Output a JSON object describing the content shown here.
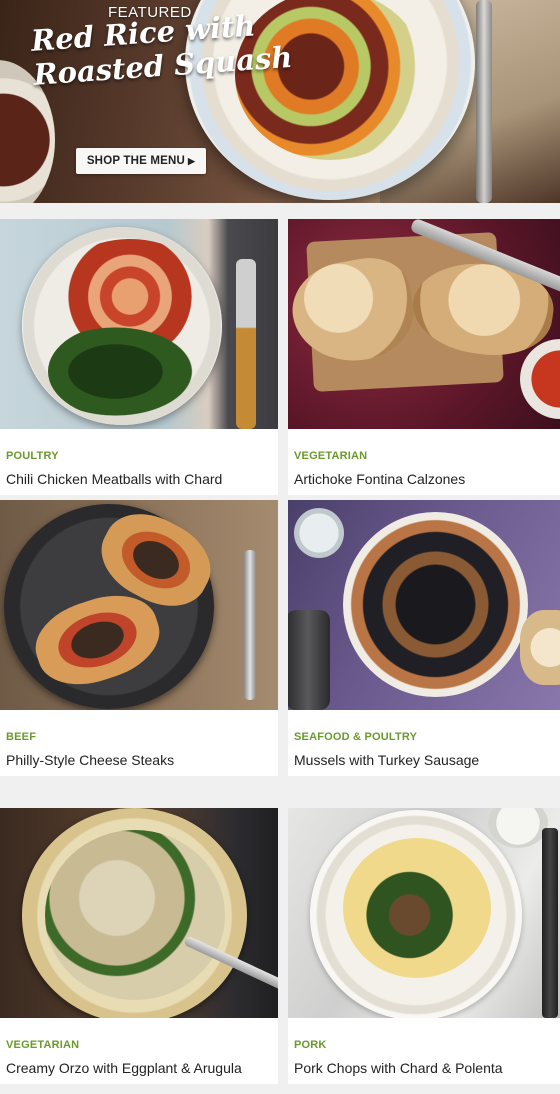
{
  "hero": {
    "kicker": "FEATURED",
    "title": "Red Rice with Roasted Squash",
    "button_label": "SHOP THE MENU",
    "button_icon": "caret-right-icon"
  },
  "colors": {
    "category": "#6a9a2c",
    "background": "#f0f0f0",
    "card": "#ffffff"
  },
  "recipes": [
    {
      "category": "POULTRY",
      "title": "Chili Chicken Meatballs with Chard"
    },
    {
      "category": "VEGETARIAN",
      "title": "Artichoke Fontina Calzones"
    },
    {
      "category": "BEEF",
      "title": "Philly-Style Cheese Steaks"
    },
    {
      "category": "SEAFOOD & POULTRY",
      "title": "Mussels with Turkey Sausage"
    },
    {
      "category": "VEGETARIAN",
      "title": "Creamy Orzo with Eggplant & Arugula"
    },
    {
      "category": "PORK",
      "title": "Pork Chops with Chard & Polenta"
    }
  ]
}
